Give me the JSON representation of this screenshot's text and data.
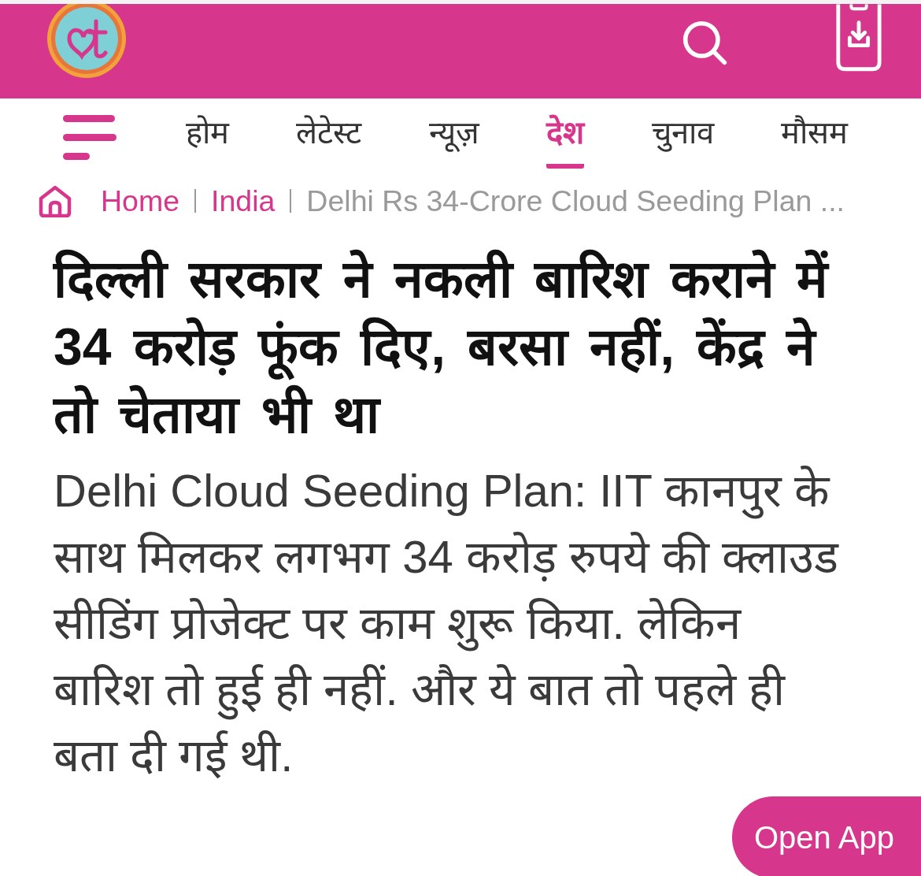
{
  "nav": {
    "items": [
      {
        "label": "होम",
        "selected": false
      },
      {
        "label": "लेटेस्ट",
        "selected": false
      },
      {
        "label": "न्यूज़",
        "selected": false
      },
      {
        "label": "देश",
        "selected": true
      },
      {
        "label": "चुनाव",
        "selected": false
      },
      {
        "label": "मौसम",
        "selected": false
      }
    ]
  },
  "breadcrumb": [
    {
      "label": "Home",
      "kind": "link"
    },
    {
      "label": "India",
      "kind": "link"
    },
    {
      "label": "Delhi Rs 34-Crore Cloud Seeding Plan ...",
      "kind": "current"
    }
  ],
  "article": {
    "headline": "दिल्ली सरकार ने नकली बारिश कराने में 34 करोड़ फूंक दिए, बरसा नहीं, केंद्र ने तो चेताया भी था",
    "summary": "Delhi Cloud Seeding Plan: IIT कानपुर के साथ मिलकर लगभग 34 करोड़ रुपये की क्लाउड सीडिंग प्रोजेक्ट पर काम शुरू किया. लेकिन बारिश तो हुई ही नहीं. और ये बात तो पहले ही बता दी गई थी."
  },
  "open_app_button": {
    "label": "Open App"
  }
}
